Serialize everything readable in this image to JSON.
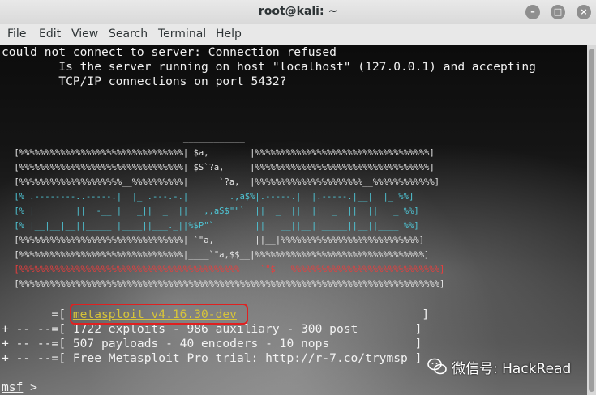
{
  "window": {
    "title": "root@kali: ~",
    "buttons": {
      "minimize": "–",
      "maximize": "□",
      "close": "×"
    }
  },
  "menu": [
    "File",
    "Edit",
    "View",
    "Search",
    "Terminal",
    "Help"
  ],
  "terminal": {
    "error_lines": [
      "could not connect to server: Connection refused",
      "        Is the server running on host \"localhost\" (127.0.0.1) and accepting",
      "        TCP/IP connections on port 5432?"
    ],
    "banner_lines": [
      "                                  ____________",
      " [%%%%%%%%%%%%%%%%%%%%%%%%%%%%%%%%| $a,        |%%%%%%%%%%%%%%%%%%%%%%%%%%%%%%%%%%]",
      " [%%%%%%%%%%%%%%%%%%%%%%%%%%%%%%%%| $S`?a,     |%%%%%%%%%%%%%%%%%%%%%%%%%%%%%%%%%%]",
      " [%%%%%%%%%%%%%%%%%%%%__%%%%%%%%%%|      `?a,  |%%%%%%%%%%%%%%%%%%%%%__%%%%%%%%%%%%]",
      " [% .--------..-----.|  |_ .---.-.|        .,a$%|.-----.|  |.-----.|__|  |_ %%]",
      " [% |        ||  -__||   _||  _  ||   ,,aS$\"\"`  ||  _  ||  ||  _  ||  ||   _|%%]",
      " [% |__|__|__||_____||____||___._||%$P\"`        ||   __||__||_____||__||____|%%]",
      " [%%%%%%%%%%%%%%%%%%%%%%%%%%%%%%%%| `\"a,        ||__|%%%%%%%%%%%%%%%%%%%%%%%%%%%]",
      " [%%%%%%%%%%%%%%%%%%%%%%%%%%%%%%%%|____`\"a,$$__|%%%%%%%%%%%%%%%%%%%%%%%%%%%%%%%%%]",
      " [%%%%%%%%%%%%%%%%%%%%%%%%%%%%%%%%%%%%%%%%%%%    `\"$   %%%%%%%%%%%%%%%%%%%%%%%%%%%%%]",
      " [%%%%%%%%%%%%%%%%%%%%%%%%%%%%%%%%%%%%%%%%%%%%%%%%%%%%%%%%%%%%%%%%%%%%%%%%%%%%%%%%%%]"
    ],
    "version_prefix": "       =[ ",
    "version": "metasploit v4.16.30-dev",
    "version_suffix": "                          ]",
    "stats_lines": [
      "+ -- --=[ 1722 exploits - 986 auxiliary - 300 post        ]",
      "+ -- --=[ 507 payloads - 40 encoders - 10 nops            ]",
      "+ -- --=[ Free Metasploit Pro trial: http://r-7.co/trymsp ]"
    ],
    "prompt_cmd": "msf",
    "prompt_sym": " >"
  },
  "watermark": {
    "text": "微信号: HackRead",
    "icon": "wechat-icon"
  },
  "colors": {
    "red_box": "#e02020",
    "version_text": "#d6c33a",
    "banner_red": "#e83e3e",
    "banner_cyan": "#4fc6d6",
    "banner_green": "#7cd86a"
  }
}
